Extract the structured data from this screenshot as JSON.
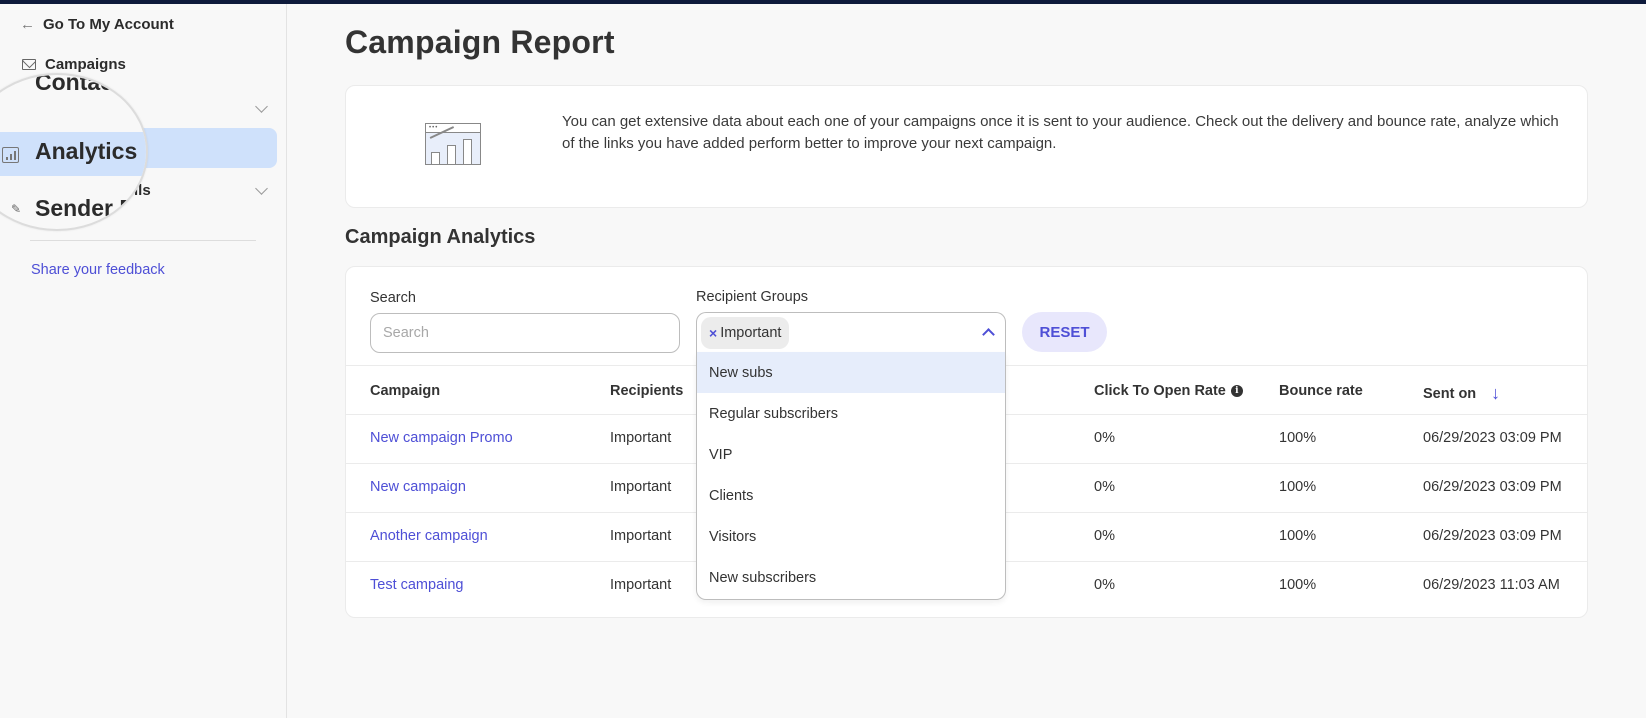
{
  "sidebar": {
    "back_link": "Go To My Account",
    "items": [
      {
        "label": "Campaigns",
        "icon": "envelope-icon"
      },
      {
        "label": "Contacts",
        "icon": "contacts-icon",
        "expandable": true
      },
      {
        "label": "Analytics",
        "icon": "bar-chart-icon",
        "active": true
      },
      {
        "label": "Sender Details",
        "icon": "sender-icon",
        "expandable": true
      }
    ],
    "magnifier": {
      "contacts_fragment": "Contac",
      "analytics_label": "Analytics",
      "sender_fragment": "Sender D",
      "details_fragment": "ils"
    },
    "feedback_link": "Share your feedback"
  },
  "page": {
    "title": "Campaign Report",
    "info_text": "You can get extensive data about each one of your campaigns once it is sent to your audience. Check out the delivery and bounce rate, analyze which of the links you have added perform better to improve your next campaign.",
    "section_title": "Campaign Analytics"
  },
  "filters": {
    "search_label": "Search",
    "search_placeholder": "Search",
    "search_value": "",
    "groups_label": "Recipient Groups",
    "selected_chip": "Important",
    "chip_remove": "×",
    "reset_label": "RESET",
    "dropdown_options": [
      "New subs",
      "Regular subscribers",
      "VIP",
      "Clients",
      "Visitors",
      "New subscribers"
    ],
    "highlighted_option": "New subs"
  },
  "table": {
    "columns": [
      "Campaign",
      "Recipients",
      "Click To Open Rate",
      "Bounce rate",
      "Sent on"
    ],
    "sort_indicator": "↓",
    "info_icon": "i",
    "rows": [
      {
        "campaign": "New campaign Promo",
        "recipients": "Important",
        "cto_rate": "0%",
        "bounce_rate": "100%",
        "sent_on": "06/29/2023 03:09 PM"
      },
      {
        "campaign": "New campaign",
        "recipients": "Important",
        "cto_rate": "0%",
        "bounce_rate": "100%",
        "sent_on": "06/29/2023 03:09 PM"
      },
      {
        "campaign": "Another campaign",
        "recipients": "Important",
        "cto_rate": "0%",
        "bounce_rate": "100%",
        "sent_on": "06/29/2023 03:09 PM"
      },
      {
        "campaign": "Test campaing",
        "recipients": "Important",
        "cto_rate": "0%",
        "bounce_rate": "100%",
        "sent_on": "06/29/2023 11:03 AM"
      }
    ]
  },
  "colors": {
    "accent": "#4e4fd6",
    "active_nav": "#cfe1fb",
    "topbar": "#0e1a3b",
    "reset_bg": "#e8e7fc"
  }
}
